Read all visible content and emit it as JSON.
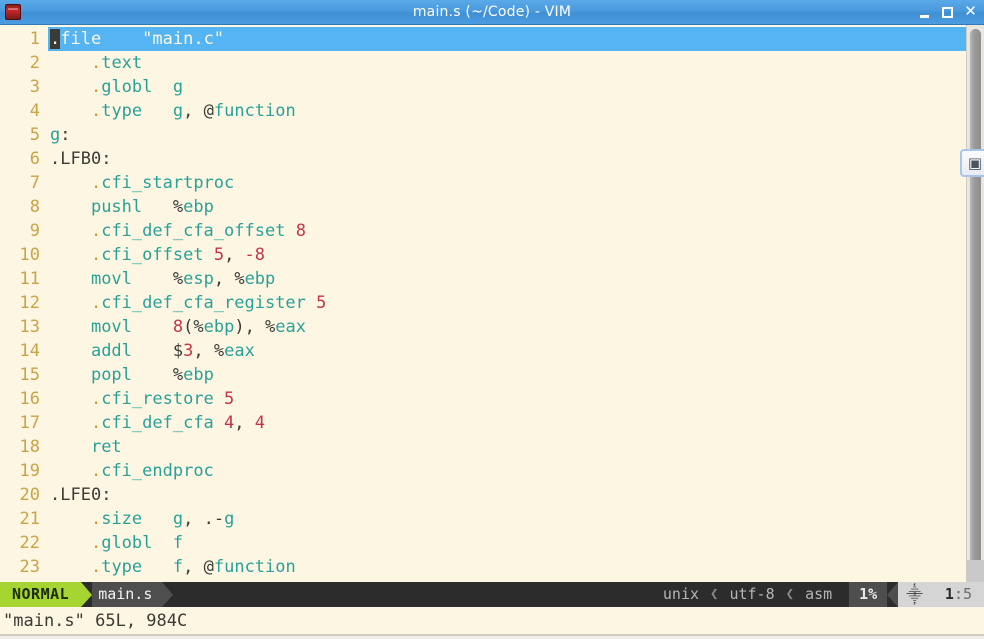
{
  "window": {
    "title": "main.s (~/Code) - VIM",
    "icon_name": "vim-icon",
    "controls": {
      "minimize": "_",
      "maximize": "□",
      "close": "✕"
    }
  },
  "editor": {
    "filetype": "asm",
    "lines": [
      {
        "n": "1",
        "cursor": true,
        "tokens": [
          {
            "t": ".",
            "c": "dir",
            "cursor": true
          },
          {
            "t": "file",
            "c": "kw"
          },
          {
            "t": "    ",
            "c": "plain"
          },
          {
            "t": "\"main.c\"",
            "c": "str"
          }
        ]
      },
      {
        "n": "2",
        "cursor": false,
        "tokens": [
          {
            "t": "    ",
            "c": "plain"
          },
          {
            "t": ".",
            "c": "dir"
          },
          {
            "t": "text",
            "c": "kw"
          }
        ]
      },
      {
        "n": "3",
        "cursor": false,
        "tokens": [
          {
            "t": "    ",
            "c": "plain"
          },
          {
            "t": ".",
            "c": "dir"
          },
          {
            "t": "globl",
            "c": "kw"
          },
          {
            "t": "  ",
            "c": "plain"
          },
          {
            "t": "g",
            "c": "ident"
          }
        ]
      },
      {
        "n": "4",
        "cursor": false,
        "tokens": [
          {
            "t": "    ",
            "c": "plain"
          },
          {
            "t": ".",
            "c": "dir"
          },
          {
            "t": "type",
            "c": "kw"
          },
          {
            "t": "   ",
            "c": "plain"
          },
          {
            "t": "g",
            "c": "ident"
          },
          {
            "t": ", ",
            "c": "plain"
          },
          {
            "t": "@",
            "c": "plain"
          },
          {
            "t": "function",
            "c": "kw"
          }
        ]
      },
      {
        "n": "5",
        "cursor": false,
        "tokens": [
          {
            "t": "g",
            "c": "ident"
          },
          {
            "t": ":",
            "c": "plain"
          }
        ]
      },
      {
        "n": "6",
        "cursor": false,
        "tokens": [
          {
            "t": ".LFB",
            "c": "label"
          },
          {
            "t": "0",
            "c": "plain"
          },
          {
            "t": ":",
            "c": "plain"
          }
        ]
      },
      {
        "n": "7",
        "cursor": false,
        "tokens": [
          {
            "t": "    ",
            "c": "plain"
          },
          {
            "t": ".",
            "c": "dir"
          },
          {
            "t": "cfi_startproc",
            "c": "kw"
          }
        ]
      },
      {
        "n": "8",
        "cursor": false,
        "tokens": [
          {
            "t": "    ",
            "c": "plain"
          },
          {
            "t": "pushl",
            "c": "kw"
          },
          {
            "t": "   ",
            "c": "plain"
          },
          {
            "t": "%",
            "c": "plain"
          },
          {
            "t": "ebp",
            "c": "ident"
          }
        ]
      },
      {
        "n": "9",
        "cursor": false,
        "tokens": [
          {
            "t": "    ",
            "c": "plain"
          },
          {
            "t": ".",
            "c": "dir"
          },
          {
            "t": "cfi_def_cfa_offset",
            "c": "kw"
          },
          {
            "t": " ",
            "c": "plain"
          },
          {
            "t": "8",
            "c": "num"
          }
        ]
      },
      {
        "n": "10",
        "cursor": false,
        "tokens": [
          {
            "t": "    ",
            "c": "plain"
          },
          {
            "t": ".",
            "c": "dir"
          },
          {
            "t": "cfi_offset",
            "c": "kw"
          },
          {
            "t": " ",
            "c": "plain"
          },
          {
            "t": "5",
            "c": "num"
          },
          {
            "t": ", ",
            "c": "plain"
          },
          {
            "t": "-8",
            "c": "num"
          }
        ]
      },
      {
        "n": "11",
        "cursor": false,
        "tokens": [
          {
            "t": "    ",
            "c": "plain"
          },
          {
            "t": "movl",
            "c": "kw"
          },
          {
            "t": "    ",
            "c": "plain"
          },
          {
            "t": "%",
            "c": "plain"
          },
          {
            "t": "esp",
            "c": "ident"
          },
          {
            "t": ", ",
            "c": "plain"
          },
          {
            "t": "%",
            "c": "plain"
          },
          {
            "t": "ebp",
            "c": "ident"
          }
        ]
      },
      {
        "n": "12",
        "cursor": false,
        "tokens": [
          {
            "t": "    ",
            "c": "plain"
          },
          {
            "t": ".",
            "c": "dir"
          },
          {
            "t": "cfi_def_cfa_register",
            "c": "kw"
          },
          {
            "t": " ",
            "c": "plain"
          },
          {
            "t": "5",
            "c": "num"
          }
        ]
      },
      {
        "n": "13",
        "cursor": false,
        "tokens": [
          {
            "t": "    ",
            "c": "plain"
          },
          {
            "t": "movl",
            "c": "kw"
          },
          {
            "t": "    ",
            "c": "plain"
          },
          {
            "t": "8",
            "c": "num"
          },
          {
            "t": "(",
            "c": "plain"
          },
          {
            "t": "%",
            "c": "plain"
          },
          {
            "t": "ebp",
            "c": "ident"
          },
          {
            "t": "), ",
            "c": "plain"
          },
          {
            "t": "%",
            "c": "plain"
          },
          {
            "t": "eax",
            "c": "ident"
          }
        ]
      },
      {
        "n": "14",
        "cursor": false,
        "tokens": [
          {
            "t": "    ",
            "c": "plain"
          },
          {
            "t": "addl",
            "c": "kw"
          },
          {
            "t": "    ",
            "c": "plain"
          },
          {
            "t": "$",
            "c": "plain"
          },
          {
            "t": "3",
            "c": "num"
          },
          {
            "t": ", ",
            "c": "plain"
          },
          {
            "t": "%",
            "c": "plain"
          },
          {
            "t": "eax",
            "c": "ident"
          }
        ]
      },
      {
        "n": "15",
        "cursor": false,
        "tokens": [
          {
            "t": "    ",
            "c": "plain"
          },
          {
            "t": "popl",
            "c": "kw"
          },
          {
            "t": "    ",
            "c": "plain"
          },
          {
            "t": "%",
            "c": "plain"
          },
          {
            "t": "ebp",
            "c": "ident"
          }
        ]
      },
      {
        "n": "16",
        "cursor": false,
        "tokens": [
          {
            "t": "    ",
            "c": "plain"
          },
          {
            "t": ".",
            "c": "dir"
          },
          {
            "t": "cfi_restore",
            "c": "kw"
          },
          {
            "t": " ",
            "c": "plain"
          },
          {
            "t": "5",
            "c": "num"
          }
        ]
      },
      {
        "n": "17",
        "cursor": false,
        "tokens": [
          {
            "t": "    ",
            "c": "plain"
          },
          {
            "t": ".",
            "c": "dir"
          },
          {
            "t": "cfi_def_cfa",
            "c": "kw"
          },
          {
            "t": " ",
            "c": "plain"
          },
          {
            "t": "4",
            "c": "num"
          },
          {
            "t": ", ",
            "c": "plain"
          },
          {
            "t": "4",
            "c": "num"
          }
        ]
      },
      {
        "n": "18",
        "cursor": false,
        "tokens": [
          {
            "t": "    ",
            "c": "plain"
          },
          {
            "t": "ret",
            "c": "kw"
          }
        ]
      },
      {
        "n": "19",
        "cursor": false,
        "tokens": [
          {
            "t": "    ",
            "c": "plain"
          },
          {
            "t": ".",
            "c": "dir"
          },
          {
            "t": "cfi_endproc",
            "c": "kw"
          }
        ]
      },
      {
        "n": "20",
        "cursor": false,
        "tokens": [
          {
            "t": ".LFE",
            "c": "label"
          },
          {
            "t": "0",
            "c": "plain"
          },
          {
            "t": ":",
            "c": "plain"
          }
        ]
      },
      {
        "n": "21",
        "cursor": false,
        "tokens": [
          {
            "t": "    ",
            "c": "plain"
          },
          {
            "t": ".",
            "c": "dir"
          },
          {
            "t": "size",
            "c": "kw"
          },
          {
            "t": "   ",
            "c": "plain"
          },
          {
            "t": "g",
            "c": "ident"
          },
          {
            "t": ", ",
            "c": "plain"
          },
          {
            "t": ".-",
            "c": "plain"
          },
          {
            "t": "g",
            "c": "ident"
          }
        ]
      },
      {
        "n": "22",
        "cursor": false,
        "tokens": [
          {
            "t": "    ",
            "c": "plain"
          },
          {
            "t": ".",
            "c": "dir"
          },
          {
            "t": "globl",
            "c": "kw"
          },
          {
            "t": "  ",
            "c": "plain"
          },
          {
            "t": "f",
            "c": "ident"
          }
        ]
      },
      {
        "n": "23",
        "cursor": false,
        "tokens": [
          {
            "t": "    ",
            "c": "plain"
          },
          {
            "t": ".",
            "c": "dir"
          },
          {
            "t": "type",
            "c": "kw"
          },
          {
            "t": "   ",
            "c": "plain"
          },
          {
            "t": "f",
            "c": "ident"
          },
          {
            "t": ", ",
            "c": "plain"
          },
          {
            "t": "@",
            "c": "plain"
          },
          {
            "t": "function",
            "c": "kw"
          }
        ]
      }
    ]
  },
  "scrollbar": {
    "popup_glyph": "▣"
  },
  "statusline": {
    "mode": "NORMAL",
    "filename": "main.s",
    "fileformat": "unix",
    "encoding": "utf-8",
    "filetype": "asm",
    "percent": "1%",
    "position_glyph": "⸎",
    "line": "1",
    "colon": ":",
    "column": "5",
    "sep_left": "❮",
    "sep_right": "❯"
  },
  "cmdline": {
    "message": "\"main.s\" 65L, 984C"
  },
  "colors": {
    "background": "#fdf6e3",
    "cursorline": "#54b5f2",
    "linenumber": "#c8a445",
    "keyword": "#2aa198",
    "number": "#c4344a",
    "directive_dot": "#cb9a33",
    "mode_bg": "#a6d430",
    "titlebar": "#4a9ade"
  }
}
